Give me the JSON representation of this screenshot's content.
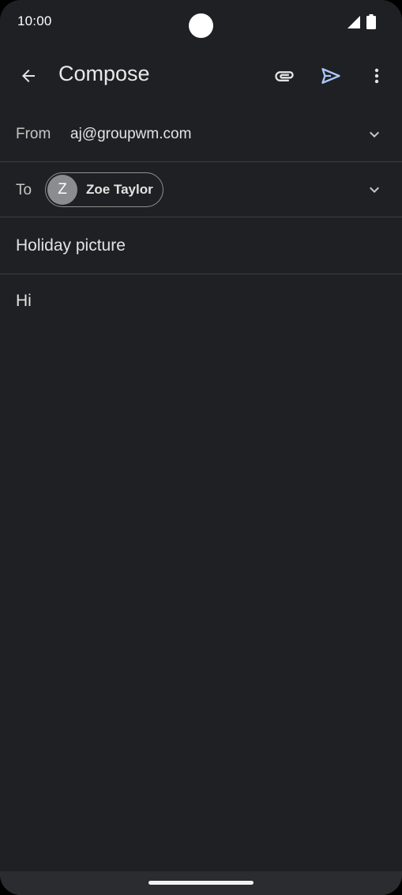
{
  "status_bar": {
    "time": "10:00",
    "signal_icon": "cellular-signal-icon",
    "battery_icon": "battery-icon"
  },
  "app_bar": {
    "title": "Compose",
    "back_icon": "arrow-back-icon",
    "attach_icon": "paperclip-icon",
    "send_icon": "send-icon",
    "more_icon": "more-vert-icon"
  },
  "from_field": {
    "label": "From",
    "value": "aj@groupwm.com"
  },
  "to_field": {
    "label": "To",
    "recipients": [
      {
        "initial": "Z",
        "name": "Zoe Taylor"
      }
    ]
  },
  "subject": {
    "value": "Holiday picture"
  },
  "body": {
    "text": "Hi"
  },
  "colors": {
    "background": "#1f2023",
    "send_accent": "#a8c7fa",
    "divider": "#3c3d40"
  }
}
